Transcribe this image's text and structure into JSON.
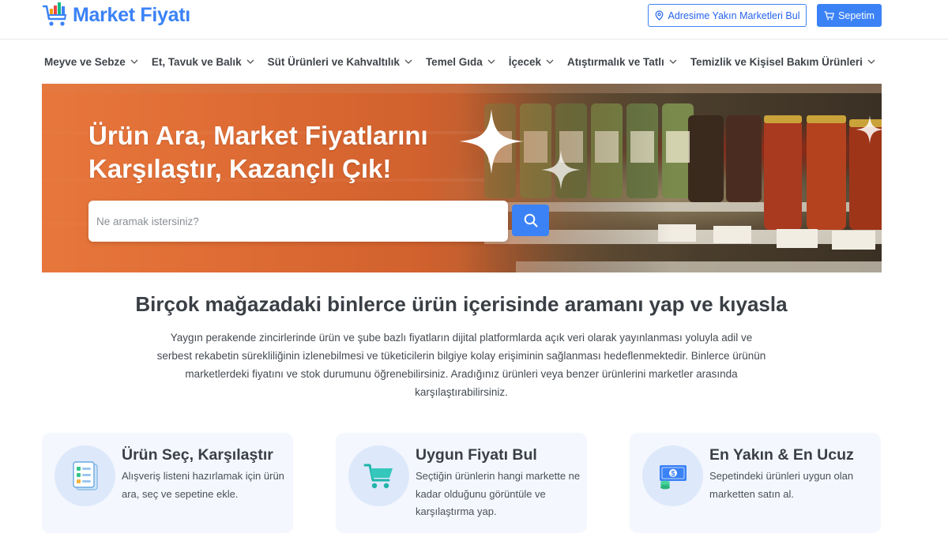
{
  "header": {
    "logo_text": "Market Fiyatı",
    "nearby_button": "Adresime Yakın Marketleri Bul",
    "cart_button": "Sepetim"
  },
  "nav": {
    "items": [
      "Meyve ve Sebze",
      "Et, Tavuk ve Balık",
      "Süt Ürünleri ve Kahvaltılık",
      "Temel Gıda",
      "İçecek",
      "Atıştırmalık ve Tatlı",
      "Temizlik ve Kişisel Bakım Ürünleri"
    ]
  },
  "hero": {
    "title_line1": "Ürün Ara, Market Fiyatlarını",
    "title_line2": "Karşılaştır, Kazançlı Çık!",
    "search_placeholder": "Ne aramak istersiniz?"
  },
  "intro": {
    "title": "Birçok mağazadaki binlerce ürün içerisinde aramanı yap ve kıyasla",
    "text": "Yaygın perakende zincirlerinde ürün ve şube bazlı fiyatların dijital platformlarda açık veri olarak yayınlanması yoluyla adil ve serbest rekabetin sürekliliğinin izlenebilmesi ve tüketicilerin bilgiye kolay erişiminin sağlanması hedeflenmektedir. Binlerce ürünün marketlerdeki fiyatını ve stok durumunu öğrenebilirsiniz. Aradığınız ürünleri veya benzer ürünlerini marketler arasında karşılaştırabilirsiniz."
  },
  "features": [
    {
      "title": "Ürün Seç, Karşılaştır",
      "desc": "Alışveriş listeni hazırlamak için ürün ara, seç ve sepetine ekle.",
      "icon": "checklist-icon"
    },
    {
      "title": "Uygun Fiyatı Bul",
      "desc": "Seçtiğin ürünlerin hangi markette ne kadar olduğunu görüntüle ve karşılaştırma yap.",
      "icon": "shopping-cart-icon"
    },
    {
      "title": "En Yakın & En Ucuz",
      "desc": "Sepetindeki ürünleri uygun olan marketten satın al.",
      "icon": "money-icon"
    }
  ],
  "colors": {
    "primary": "#3b82f6",
    "card_bg": "#f4f7fd",
    "icon_circle": "#dde8fb"
  }
}
